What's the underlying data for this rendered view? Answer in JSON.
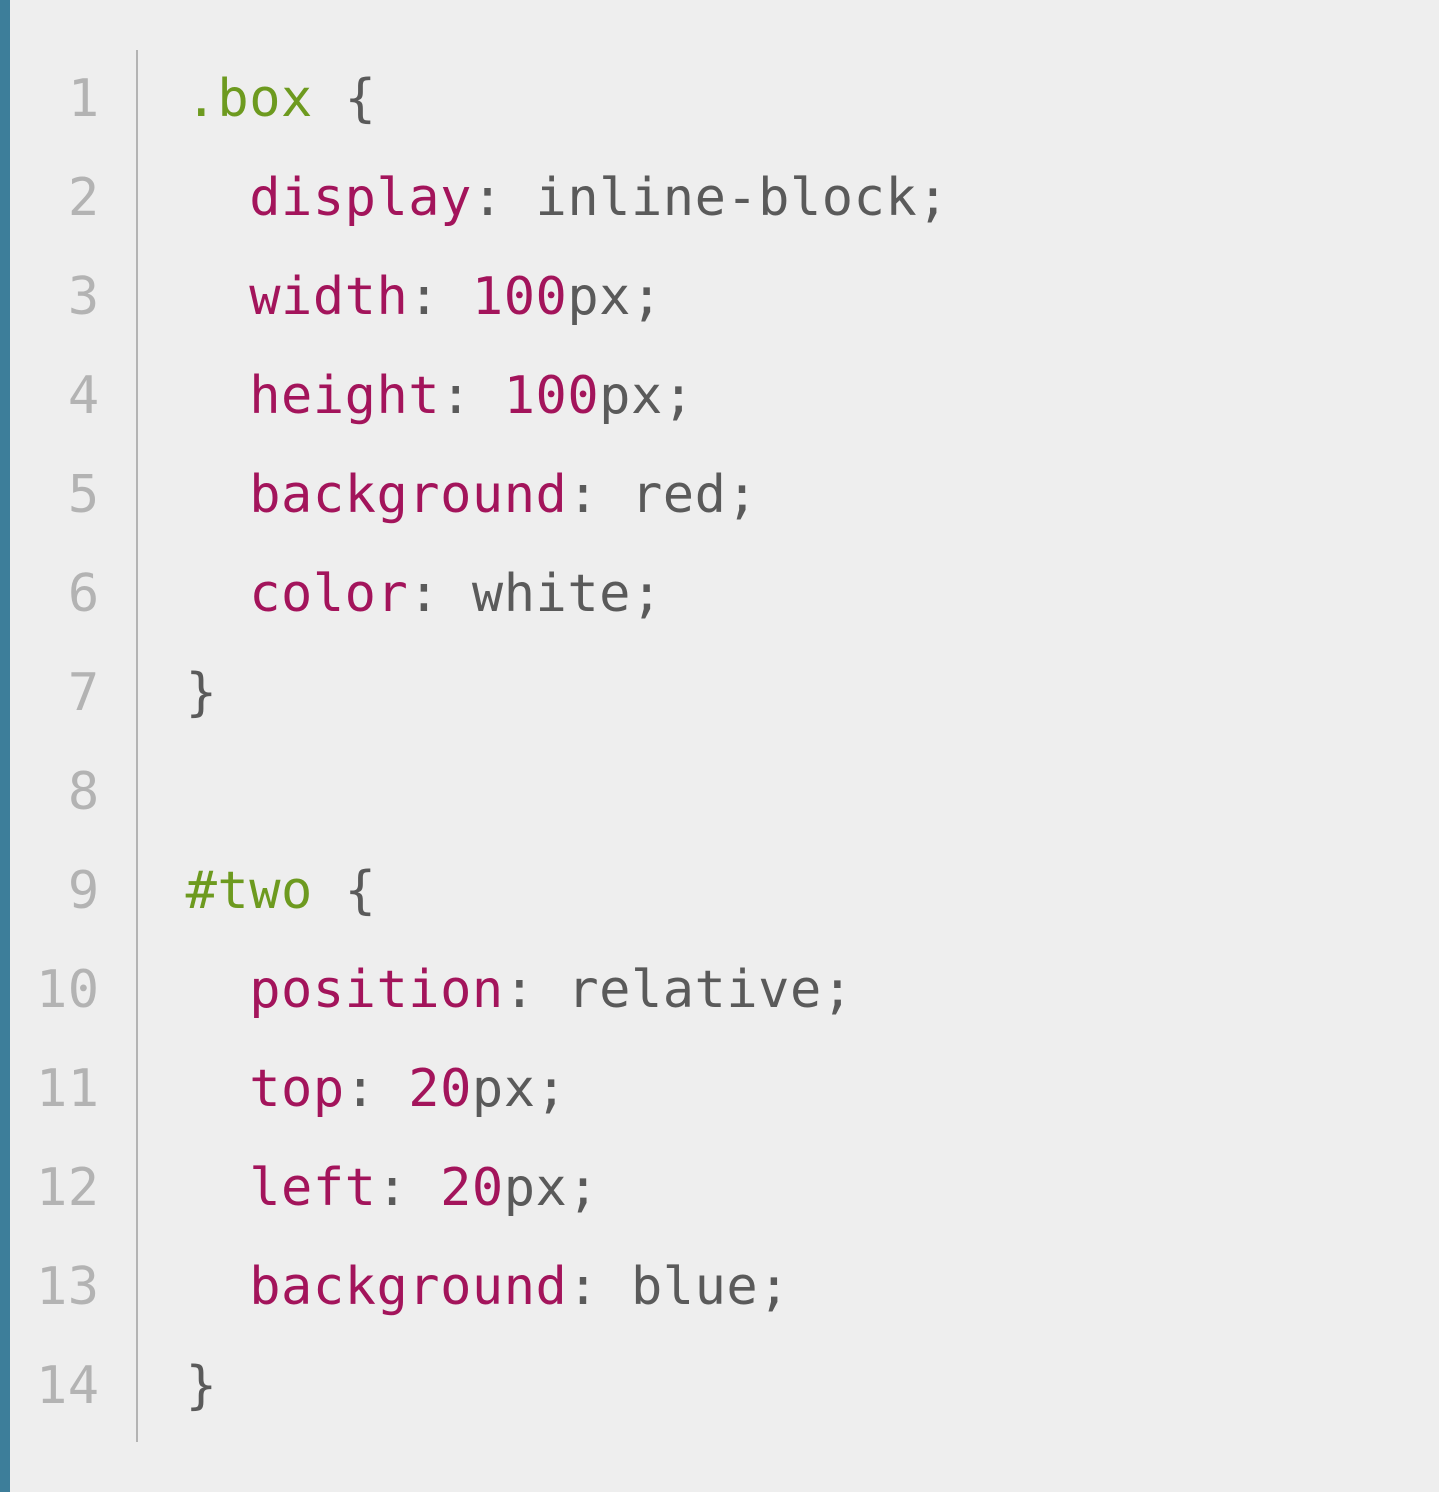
{
  "code": {
    "language": "css",
    "lines": [
      {
        "n": "1",
        "tokens": [
          {
            "t": ".box",
            "c": "selector"
          },
          {
            "t": " ",
            "c": "plain"
          },
          {
            "t": "{",
            "c": "brace"
          }
        ]
      },
      {
        "n": "2",
        "tokens": [
          {
            "t": "  ",
            "c": "plain"
          },
          {
            "t": "display",
            "c": "property"
          },
          {
            "t": ":",
            "c": "punct"
          },
          {
            "t": " ",
            "c": "plain"
          },
          {
            "t": "inline-block",
            "c": "value"
          },
          {
            "t": ";",
            "c": "punct"
          }
        ]
      },
      {
        "n": "3",
        "tokens": [
          {
            "t": "  ",
            "c": "plain"
          },
          {
            "t": "width",
            "c": "property"
          },
          {
            "t": ":",
            "c": "punct"
          },
          {
            "t": " ",
            "c": "plain"
          },
          {
            "t": "100",
            "c": "number"
          },
          {
            "t": "px",
            "c": "unit"
          },
          {
            "t": ";",
            "c": "punct"
          }
        ]
      },
      {
        "n": "4",
        "tokens": [
          {
            "t": "  ",
            "c": "plain"
          },
          {
            "t": "height",
            "c": "property"
          },
          {
            "t": ":",
            "c": "punct"
          },
          {
            "t": " ",
            "c": "plain"
          },
          {
            "t": "100",
            "c": "number"
          },
          {
            "t": "px",
            "c": "unit"
          },
          {
            "t": ";",
            "c": "punct"
          }
        ]
      },
      {
        "n": "5",
        "tokens": [
          {
            "t": "  ",
            "c": "plain"
          },
          {
            "t": "background",
            "c": "property"
          },
          {
            "t": ":",
            "c": "punct"
          },
          {
            "t": " ",
            "c": "plain"
          },
          {
            "t": "red",
            "c": "value"
          },
          {
            "t": ";",
            "c": "punct"
          }
        ]
      },
      {
        "n": "6",
        "tokens": [
          {
            "t": "  ",
            "c": "plain"
          },
          {
            "t": "color",
            "c": "property"
          },
          {
            "t": ":",
            "c": "punct"
          },
          {
            "t": " ",
            "c": "plain"
          },
          {
            "t": "white",
            "c": "value"
          },
          {
            "t": ";",
            "c": "punct"
          }
        ]
      },
      {
        "n": "7",
        "tokens": [
          {
            "t": "}",
            "c": "brace"
          }
        ]
      },
      {
        "n": "8",
        "tokens": [
          {
            "t": "",
            "c": "plain"
          }
        ]
      },
      {
        "n": "9",
        "tokens": [
          {
            "t": "#two",
            "c": "selector"
          },
          {
            "t": " ",
            "c": "plain"
          },
          {
            "t": "{",
            "c": "brace"
          }
        ]
      },
      {
        "n": "10",
        "tokens": [
          {
            "t": "  ",
            "c": "plain"
          },
          {
            "t": "position",
            "c": "property"
          },
          {
            "t": ":",
            "c": "punct"
          },
          {
            "t": " ",
            "c": "plain"
          },
          {
            "t": "relative",
            "c": "value"
          },
          {
            "t": ";",
            "c": "punct"
          }
        ]
      },
      {
        "n": "11",
        "tokens": [
          {
            "t": "  ",
            "c": "plain"
          },
          {
            "t": "top",
            "c": "property"
          },
          {
            "t": ":",
            "c": "punct"
          },
          {
            "t": " ",
            "c": "plain"
          },
          {
            "t": "20",
            "c": "number"
          },
          {
            "t": "px",
            "c": "unit"
          },
          {
            "t": ";",
            "c": "punct"
          }
        ]
      },
      {
        "n": "12",
        "tokens": [
          {
            "t": "  ",
            "c": "plain"
          },
          {
            "t": "left",
            "c": "property"
          },
          {
            "t": ":",
            "c": "punct"
          },
          {
            "t": " ",
            "c": "plain"
          },
          {
            "t": "20",
            "c": "number"
          },
          {
            "t": "px",
            "c": "unit"
          },
          {
            "t": ";",
            "c": "punct"
          }
        ]
      },
      {
        "n": "13",
        "tokens": [
          {
            "t": "  ",
            "c": "plain"
          },
          {
            "t": "background",
            "c": "property"
          },
          {
            "t": ":",
            "c": "punct"
          },
          {
            "t": " ",
            "c": "plain"
          },
          {
            "t": "blue",
            "c": "value"
          },
          {
            "t": ";",
            "c": "punct"
          }
        ]
      },
      {
        "n": "14",
        "tokens": [
          {
            "t": "}",
            "c": "brace"
          }
        ]
      }
    ]
  }
}
